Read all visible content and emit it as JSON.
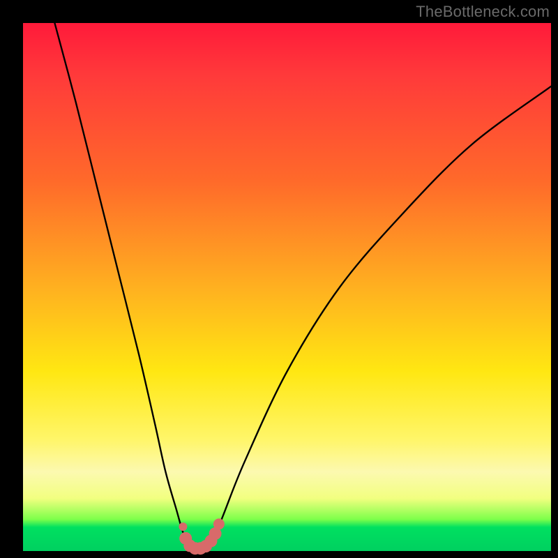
{
  "watermark": "TheBottleneck.com",
  "chart_data": {
    "type": "line",
    "title": "",
    "xlabel": "",
    "ylabel": "",
    "xlim": [
      0,
      100
    ],
    "ylim": [
      0,
      100
    ],
    "series": [
      {
        "name": "bottleneck-curve",
        "x": [
          6,
          10,
          14,
          18,
          22,
          25,
          27,
          29,
          30.5,
          32,
          33,
          34,
          35,
          36,
          38,
          42,
          50,
          60,
          72,
          85,
          100
        ],
        "y": [
          100,
          85,
          69,
          53,
          37,
          24,
          15,
          8,
          3,
          0.8,
          0.4,
          0.4,
          0.8,
          2,
          7,
          17,
          34,
          50,
          64,
          77,
          88
        ]
      }
    ],
    "markers": {
      "name": "highlight-dots",
      "color": "#d86a6a",
      "points": [
        {
          "x": 30.3,
          "y": 4.6,
          "r": 6
        },
        {
          "x": 30.8,
          "y": 2.4,
          "r": 9
        },
        {
          "x": 31.6,
          "y": 1.0,
          "r": 9
        },
        {
          "x": 32.6,
          "y": 0.5,
          "r": 9
        },
        {
          "x": 33.6,
          "y": 0.5,
          "r": 9
        },
        {
          "x": 34.6,
          "y": 0.9,
          "r": 9
        },
        {
          "x": 35.6,
          "y": 1.9,
          "r": 9
        },
        {
          "x": 36.4,
          "y": 3.3,
          "r": 9
        },
        {
          "x": 37.1,
          "y": 5.1,
          "r": 8
        }
      ]
    },
    "gradient_stops": [
      {
        "pos": 0.0,
        "color": "#ff1a3a"
      },
      {
        "pos": 0.3,
        "color": "#ff6a2a"
      },
      {
        "pos": 0.66,
        "color": "#ffe712"
      },
      {
        "pos": 0.9,
        "color": "#f2ff80"
      },
      {
        "pos": 0.955,
        "color": "#00e060"
      },
      {
        "pos": 1.0,
        "color": "#00d060"
      }
    ]
  }
}
